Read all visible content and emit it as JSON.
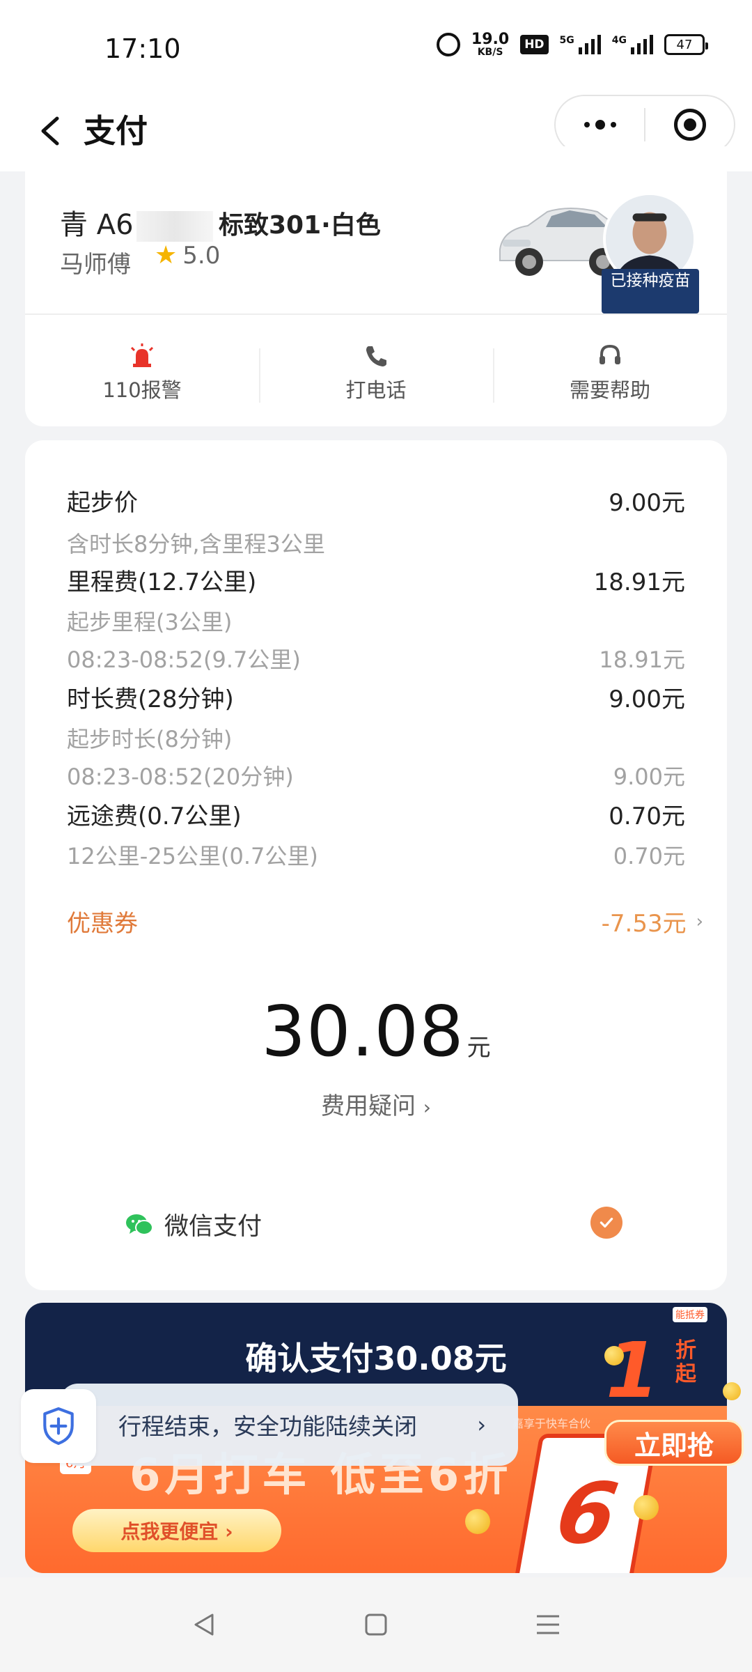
{
  "status_bar": {
    "time": "17:10",
    "speed_value": "19.0",
    "speed_unit": "KB/S",
    "hd_label": "HD",
    "net1_label": "5G",
    "net2_label": "4G",
    "battery": "47"
  },
  "header": {
    "title": "支付"
  },
  "driver": {
    "plate": "青 A6",
    "car_model": "标致301·白色",
    "name": "马师傅",
    "rating": "5.0",
    "vaccine_badge": "已接种疫苗"
  },
  "actions": [
    {
      "label": "110报警",
      "icon": "alarm-siren-icon"
    },
    {
      "label": "打电话",
      "icon": "phone-icon"
    },
    {
      "label": "需要帮助",
      "icon": "headset-icon"
    }
  ],
  "fees": {
    "base_label": "起步价",
    "base_value": "9.00元",
    "base_note": "含时长8分钟,含里程3公里",
    "mileage_label": "里程费(12.7公里)",
    "mileage_value": "18.91元",
    "mileage_sub1": "起步里程(3公里)",
    "mileage_sub2_label": "08:23-08:52(9.7公里)",
    "mileage_sub2_value": "18.91元",
    "duration_label": "时长费(28分钟)",
    "duration_value": "9.00元",
    "duration_sub1": "起步时长(8分钟)",
    "duration_sub2_label": "08:23-08:52(20分钟)",
    "duration_sub2_value": "9.00元",
    "longdist_label": "远途费(0.7公里)",
    "longdist_value": "0.70元",
    "longdist_sub_label": "12公里-25公里(0.7公里)",
    "longdist_sub_value": "0.70元",
    "coupon_label": "优惠券",
    "coupon_value": "-7.53元"
  },
  "total": {
    "amount": "30.08",
    "unit": "元",
    "question": "费用疑问"
  },
  "payment": {
    "method": "微信支付"
  },
  "confirm": {
    "label": "确认支付30.08元",
    "promo_number": "1",
    "promo_zhe": "折起",
    "promo_tag": "能抵券",
    "grab": "立即抢"
  },
  "ad": {
    "headline": "6月打车 低至6折",
    "small_tag": "6月",
    "cta": "点我更便宜 ›",
    "six": "6",
    "ticker": "嘉享于快车合伙"
  },
  "toast": {
    "message": "行程结束，安全功能陆续关闭"
  },
  "colors": {
    "accent_orange": "#f08a4b",
    "coupon_orange": "#e07a3a",
    "confirm_navy": "#132348",
    "wechat_green": "#2fc25b",
    "alarm_red": "#e8332a"
  }
}
